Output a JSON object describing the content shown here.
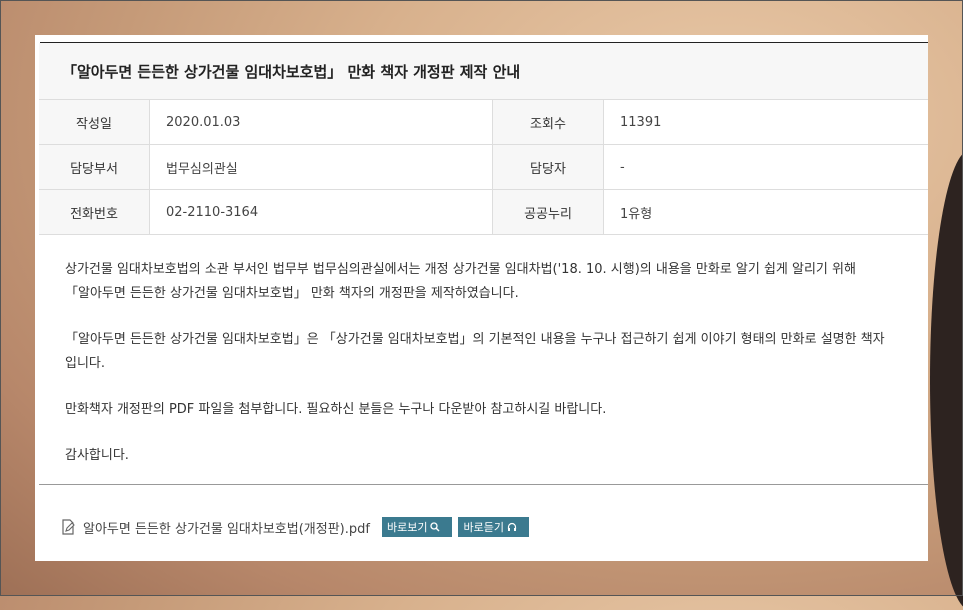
{
  "post": {
    "title": "「알아두면 든든한 상가건물 임대차보호법」 만화 책자 개정판 제작 안내"
  },
  "meta": {
    "row1": {
      "label_a": "작성일",
      "value_a": "2020.01.03",
      "label_b": "조회수",
      "value_b": "11391"
    },
    "row2": {
      "label_a": "담당부서",
      "value_a": "법무심의관실",
      "label_b": "담당자",
      "value_b": "-"
    },
    "row3": {
      "label_a": "전화번호",
      "value_a": "02-2110-3164",
      "label_b": "공공누리",
      "value_b": "1유형"
    }
  },
  "body": {
    "p1_line1": "상가건물 임대차보호법의 소관 부서인 법무부 법무심의관실에서는 개정 상가건물 임대차법('18. 10. 시행)의 내용을 만화로 알기 쉽게 알리기 위해",
    "p1_line2": "「알아두면 든든한 상가건물 임대차보호법」 만화 책자의 개정판을 제작하였습니다.",
    "p2_line1": "「알아두면 든든한 상가건물 임대차보호법」은 「상가건물 임대차보호법」의 기본적인 내용을 누구나 접근하기 쉽게 이야기 형태의 만화로 설명한 책자",
    "p2_line2": "입니다.",
    "p3": "만화책자 개정판의 PDF 파일을 첨부합니다. 필요하신 분들은 누구나 다운받아 참고하시길 바랍니다.",
    "p4": "감사합니다."
  },
  "attachment": {
    "filename": "알아두면 든든한 상가건물 임대차보호법(개정판).pdf",
    "view_label": "바로보기",
    "listen_label": "바로듣기",
    "icon": "file-edit-icon",
    "button_color": "#3b7a8f"
  }
}
